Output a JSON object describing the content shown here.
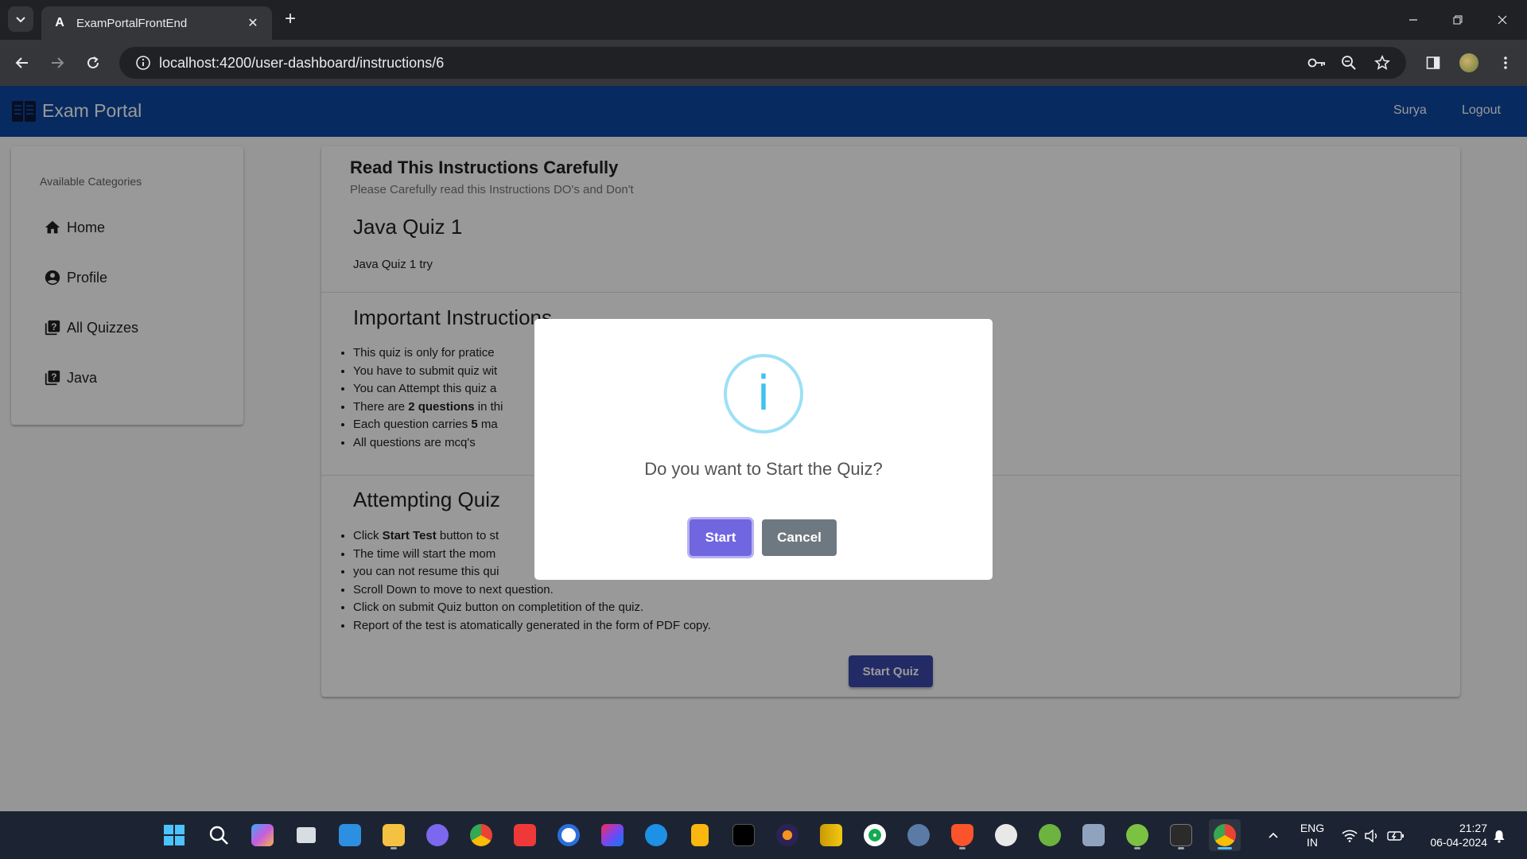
{
  "browser": {
    "tab_title": "ExamPortalFrontEnd",
    "url": "localhost:4200/user-dashboard/instructions/6"
  },
  "app": {
    "brand": "Exam Portal",
    "nav_links": [
      "Surya",
      "Logout"
    ]
  },
  "sidebar": {
    "subheader": "Available Categories",
    "items": [
      {
        "label": "Home",
        "icon": "home-icon"
      },
      {
        "label": "Profile",
        "icon": "account-circle-icon"
      },
      {
        "label": "All Quizzes",
        "icon": "quiz-icon"
      },
      {
        "label": "Java",
        "icon": "quiz-icon"
      }
    ]
  },
  "main": {
    "title": "Read This Instructions Carefully",
    "subtitle": "Please Carefully read this Instructions DO's and Don't",
    "quiz_title": "Java Quiz 1",
    "quiz_description": "Java Quiz 1 try",
    "important": {
      "heading": "Important Instructions",
      "items": [
        "This quiz is only for pratice",
        "You have to submit quiz wit",
        "You can Attempt this quiz a",
        "There are ",
        "Each question carries ",
        "All questions are mcq's"
      ],
      "bold_questions": "2 questions",
      "tail_questions": " in thi",
      "bold_marks": "5",
      "tail_marks": " ma"
    },
    "attempting": {
      "heading": "Attempting Quiz",
      "item1_pre": "Click ",
      "item1_bold": "Start Test",
      "item1_post": " button to st",
      "items": [
        "The time will start the mom",
        "you can not resume this qui",
        "Scroll Down to move to next question.",
        "Click on submit Quiz button on completition of the quiz.",
        "Report of the test is atomatically generated in the form of PDF copy."
      ]
    },
    "start_button": "Start Quiz"
  },
  "modal": {
    "icon_glyph": "i",
    "message": "Do you want to Start the Quiz?",
    "confirm_label": "Start",
    "cancel_label": "Cancel"
  },
  "taskbar": {
    "lang_top": "ENG",
    "lang_bottom": "IN",
    "time": "21:27",
    "date": "06-04-2024"
  }
}
